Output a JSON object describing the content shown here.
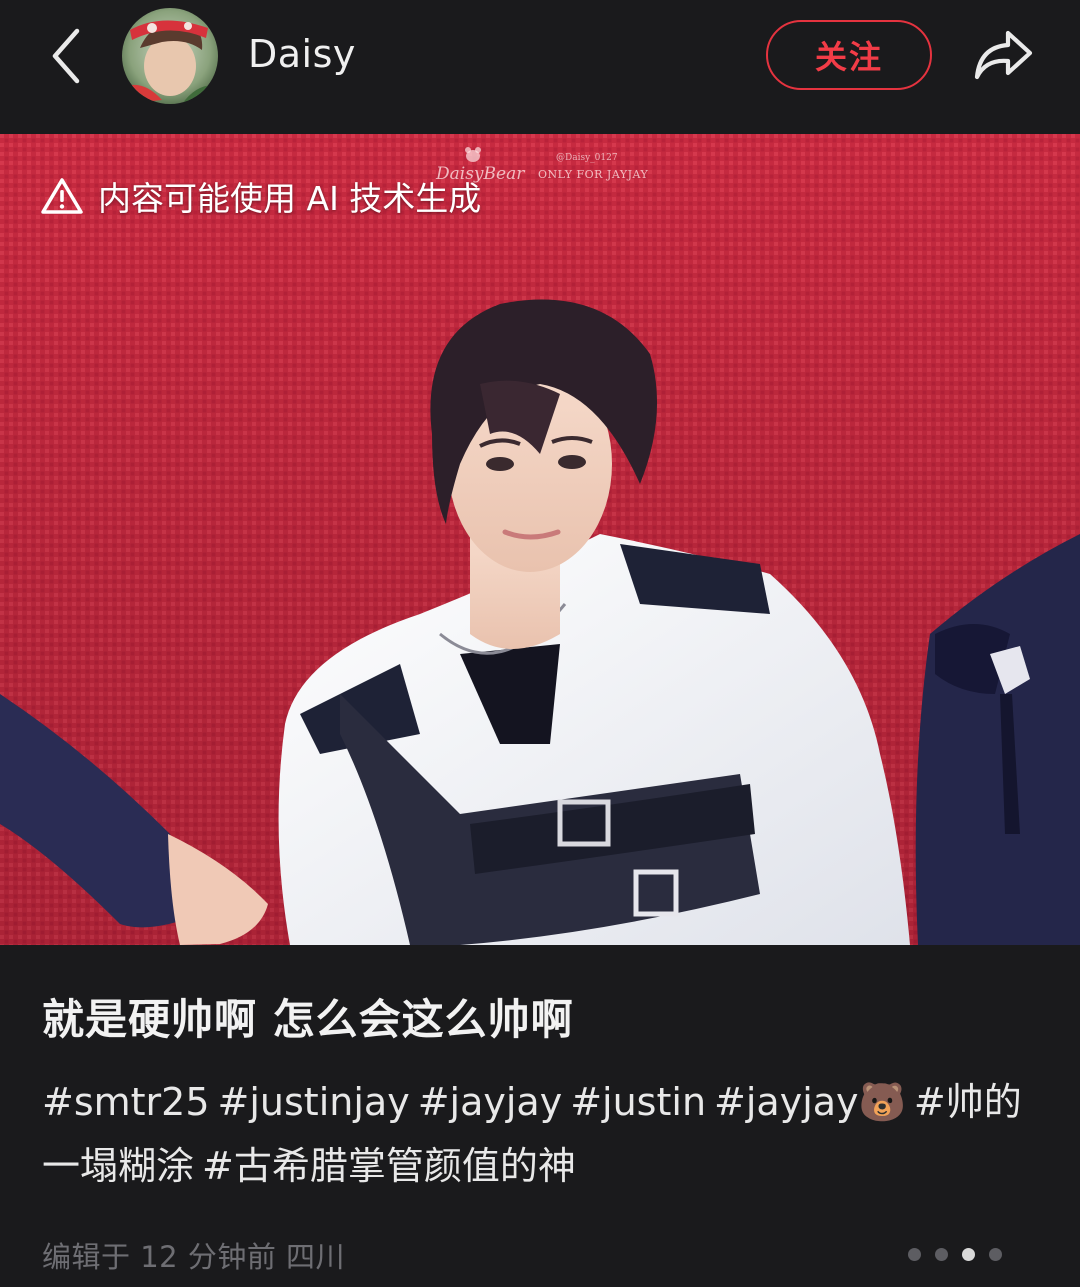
{
  "header": {
    "back_icon": "chevron-left-icon",
    "author_name": "Daisy",
    "follow_label": "关注",
    "share_icon": "share-arrow-icon",
    "accent": "#e5333f"
  },
  "media": {
    "ai_notice": "内容可能使用 AI 技术生成",
    "ai_notice_icon": "warning-triangle-icon",
    "watermark": {
      "left": "DaisyBear",
      "right_line1": "@Daisy_0127",
      "right_line2": "ONLY FOR JAYJAY"
    }
  },
  "post": {
    "title": "就是硬帅啊 怎么会这么帅啊",
    "tags": [
      "#smtr25",
      "#justinjay",
      "#jayjay",
      "#justin",
      "#jayjay🐻",
      "#帅的一塌糊涂",
      "#古希腊掌管颜值的神"
    ],
    "meta": "编辑于 12 分钟前 四川"
  }
}
